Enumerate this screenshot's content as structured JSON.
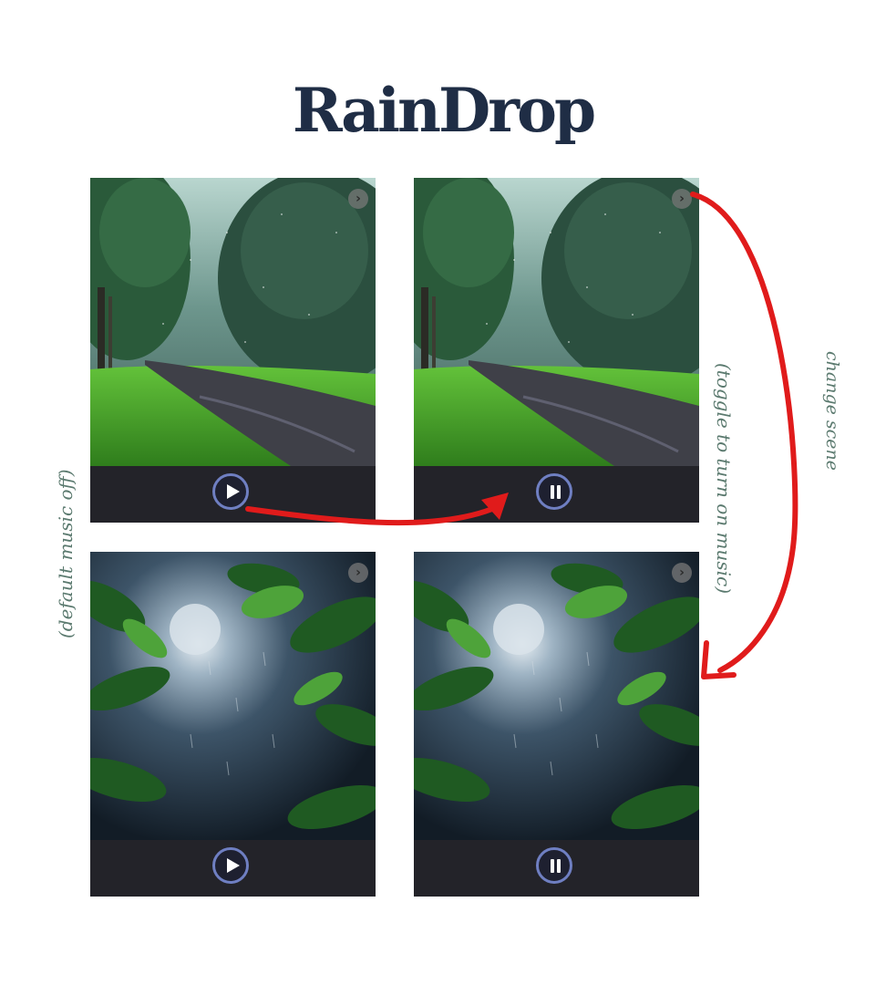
{
  "app": {
    "title": "RainDrop"
  },
  "panels": [
    {
      "scene": "forest-road-rain",
      "state": "paused",
      "control_icon": "play-icon"
    },
    {
      "scene": "forest-road-rain",
      "state": "playing",
      "control_icon": "pause-icon"
    },
    {
      "scene": "jungle-moon-rain",
      "state": "paused",
      "control_icon": "play-icon"
    },
    {
      "scene": "jungle-moon-rain",
      "state": "playing",
      "control_icon": "pause-icon"
    }
  ],
  "annotations": {
    "left": "(default music off)",
    "middle": "(toggle to turn on music)",
    "right": "change scene"
  },
  "icons": {
    "next": "next-scene-icon",
    "play": "play-icon",
    "pause": "pause-icon"
  },
  "colors": {
    "title": "#1f2d45",
    "annotation": "#5b7a6f",
    "arrow": "#e01b1b",
    "control_bar": "#232329",
    "button_ring": "#6f7fc2"
  }
}
